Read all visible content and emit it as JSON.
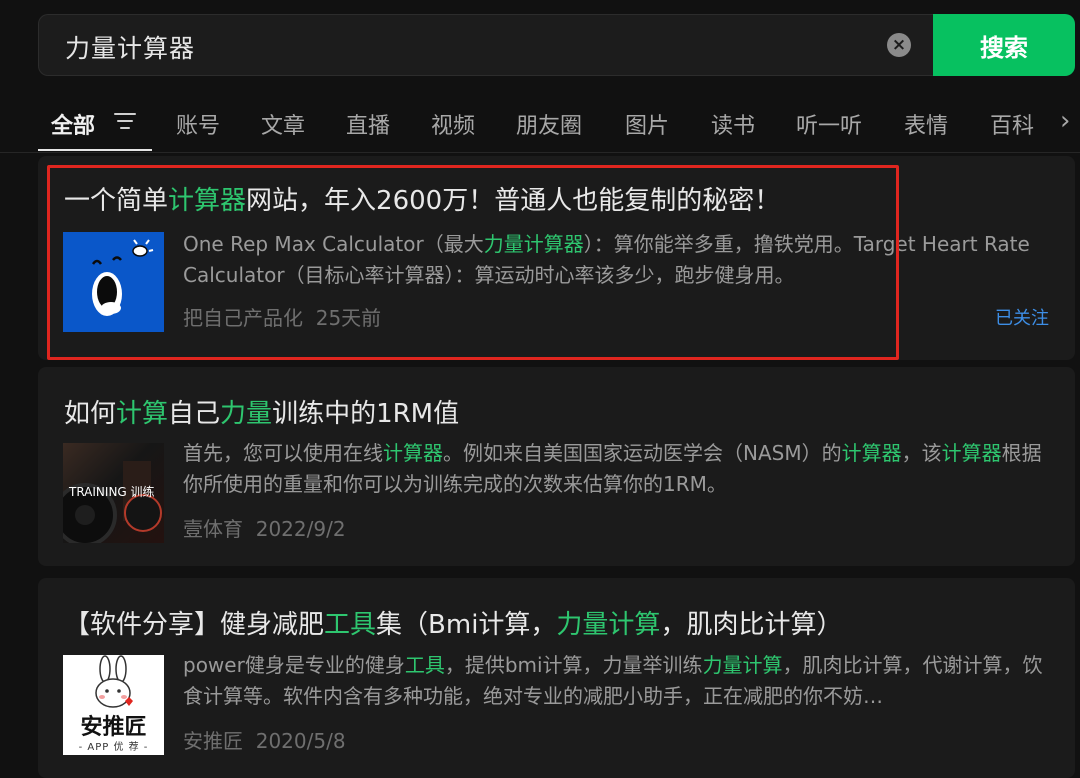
{
  "search": {
    "query": "力量计算器",
    "button_label": "搜索",
    "clear_icon": "close-circle-icon"
  },
  "tabs": {
    "items": [
      "全部",
      "账号",
      "文章",
      "直播",
      "视频",
      "朋友圈",
      "图片",
      "读书",
      "听一听",
      "表情",
      "百科"
    ],
    "filter_icon": "filter-icon",
    "more_icon": "chevron-right-icon"
  },
  "results": [
    {
      "title_parts": [
        "一个简单",
        "计算器",
        "网站，年入2600万！普通人也能复制的秘密！"
      ],
      "desc_parts": [
        "One Rep Max Calculator（最大",
        "力量计算器",
        "）：算你能举多重，撸铁党用。Target Heart Rate Calculator（目标心率计算器）：算运动时心率该多少，跑步健身用。"
      ],
      "source": "把自己产品化",
      "date": "25天前",
      "follow": "已关注"
    },
    {
      "title_parts": [
        "如何",
        "计算",
        "自己",
        "力量",
        "训练中的1RM值"
      ],
      "desc_parts": [
        "首先，您可以使用在线",
        "计算器",
        "。例如来自美国国家运动医学会（NASM）的",
        "计算器",
        "，该",
        "计算器",
        "根据你所使用的重量和你可以为训练完成的次数来估算你的1RM。"
      ],
      "thumb_text": "TRAINING 训练",
      "source": "壹体育",
      "date": "2022/9/2"
    },
    {
      "title_parts": [
        "【软件分享】健身减肥",
        "工具",
        "集（Bmi计算，",
        "力量计算",
        "，肌肉比计算）"
      ],
      "desc_parts": [
        "power健身是专业的健身",
        "工具",
        "，提供bmi计算，力量举训练",
        "力量计算",
        "，肌肉比计算，代谢计算，饮食计算等。软件内含有多种功能，绝对专业的减肥小助手，正在减肥的你不妨…"
      ],
      "thumb_text": "安推匠",
      "thumb_sub": "- APP 优 荐 -",
      "source": "安推匠",
      "date": "2020/5/8"
    }
  ],
  "colors": {
    "accent": "#07c160",
    "highlight": "#2ec66f",
    "link": "#3d8ee6",
    "annotation_box": "#e0261f"
  }
}
